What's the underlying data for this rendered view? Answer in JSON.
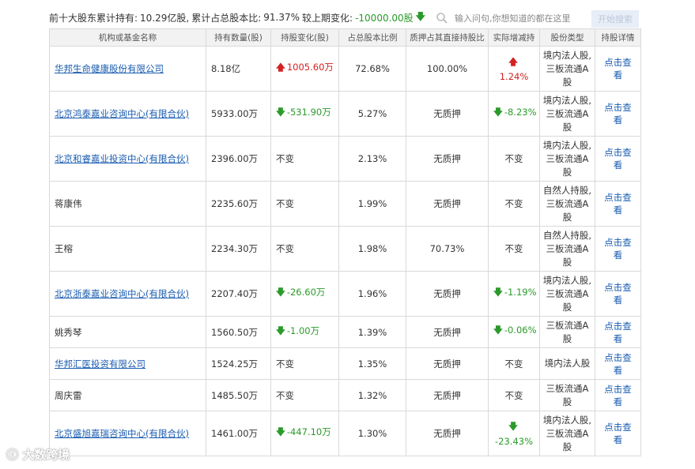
{
  "summary": {
    "label": "前十大股东累计持有:",
    "total": "10.29亿股,",
    "ratio_label": "累计占总股本比:",
    "ratio": "91.37%",
    "change_label": "较上期变化:",
    "change": "-10000.00股"
  },
  "search": {
    "placeholder": "输入问句,你想知道的都在这里",
    "button": "开始搜索"
  },
  "table": {
    "headers": [
      "机构或基金名称",
      "持有数量(股)",
      "持股变化(股)",
      "占总股本比例",
      "质押占其直接持股比",
      "实际增减持",
      "股份类型",
      "持股详情"
    ],
    "rows": [
      {
        "name": "华邦生命健康股份有限公司",
        "holding": "8.18亿",
        "change": "1005.60万",
        "ratio": "72.68%",
        "pledge": "100.00%",
        "actual": "1.24%",
        "type": "境内法人股,三板流通A股",
        "detail": "点击查看"
      },
      {
        "name": "北京鸿泰嘉业咨询中心(有限合伙)",
        "holding": "5933.00万",
        "change": "-531.90万",
        "ratio": "5.27%",
        "pledge": "无质押",
        "actual": "-8.23%",
        "type": "境内法人股,三板流通A股",
        "detail": "点击查看"
      },
      {
        "name": "北京和睿嘉业投资中心(有限合伙)",
        "holding": "2396.00万",
        "change": "不变",
        "ratio": "2.13%",
        "pledge": "无质押",
        "actual": "不变",
        "type": "境内法人股,三板流通A股",
        "detail": "点击查看"
      },
      {
        "name": "蒋康伟",
        "holding": "2235.60万",
        "change": "不变",
        "ratio": "1.99%",
        "pledge": "无质押",
        "actual": "不变",
        "type": "自然人持股,三板流通A股",
        "detail": "点击查看"
      },
      {
        "name": "王榕",
        "holding": "2234.30万",
        "change": "不变",
        "ratio": "1.98%",
        "pledge": "70.73%",
        "actual": "不变",
        "type": "自然人持股,三板流通A股",
        "detail": "点击查看"
      },
      {
        "name": "北京浙泰嘉业咨询中心(有限合伙)",
        "holding": "2207.40万",
        "change": "-26.60万",
        "ratio": "1.96%",
        "pledge": "无质押",
        "actual": "-1.19%",
        "type": "境内法人股,三板流通A股",
        "detail": "点击查看"
      },
      {
        "name": "姚秀琴",
        "holding": "1560.50万",
        "change": "-1.00万",
        "ratio": "1.39%",
        "pledge": "无质押",
        "actual": "-0.06%",
        "type": "三板流通A股",
        "detail": "点击查看"
      },
      {
        "name": "华邦汇医投资有限公司",
        "holding": "1524.25万",
        "change": "不变",
        "ratio": "1.35%",
        "pledge": "无质押",
        "actual": "不变",
        "type": "境内法人股",
        "detail": "点击查看"
      },
      {
        "name": "周庆雷",
        "holding": "1485.50万",
        "change": "不变",
        "ratio": "1.32%",
        "pledge": "无质押",
        "actual": "不变",
        "type": "三板流通A股",
        "detail": "点击查看"
      },
      {
        "name": "北京盛旭嘉瑞咨询中心(有限合伙)",
        "holding": "1461.00万",
        "change": "-447.10万",
        "ratio": "1.30%",
        "pledge": "无质押",
        "actual": "-23.43%",
        "type": "境内法人股,三板流通A股",
        "detail": "点击查看"
      }
    ]
  },
  "colors": {
    "up": "#d32222",
    "down": "#2a9a2a",
    "link": "#1a5cb0"
  },
  "watermark": "大数跨境"
}
